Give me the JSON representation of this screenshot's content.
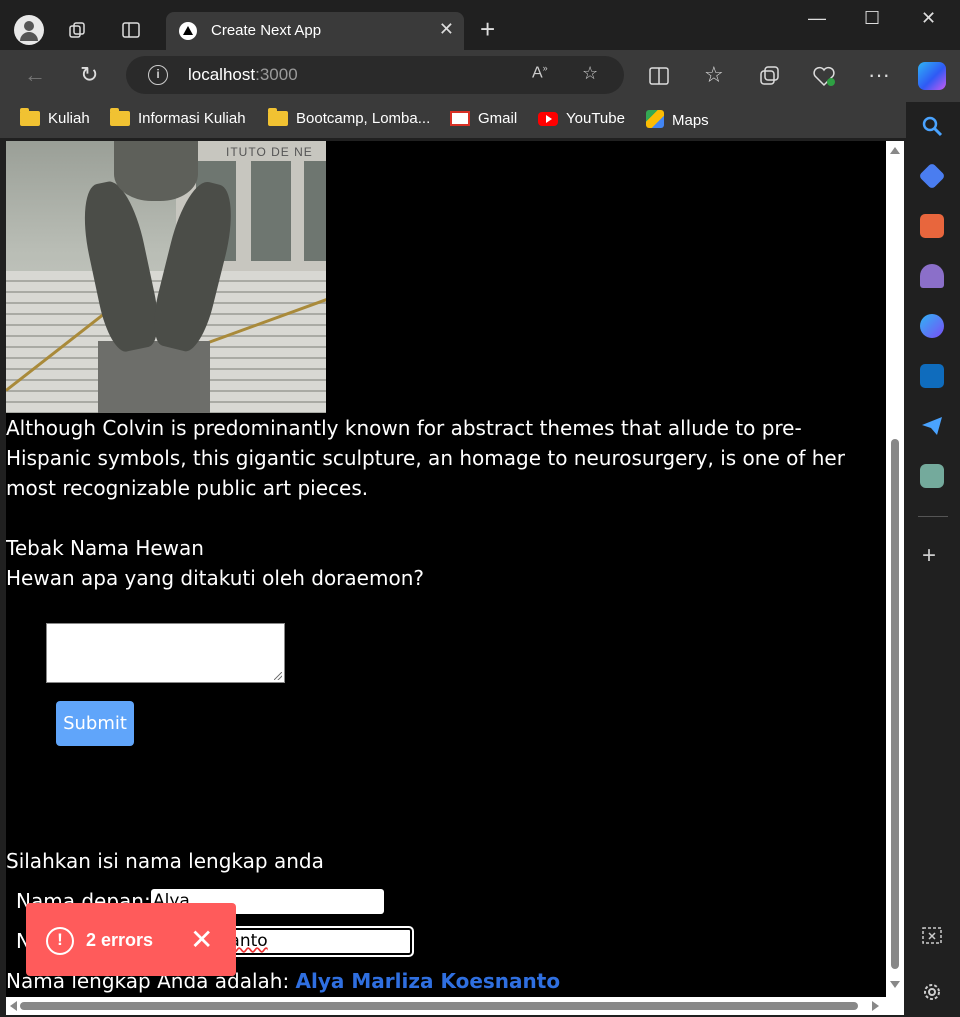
{
  "browser": {
    "tab_title": "Create Next App",
    "url_host": "localhost",
    "url_port": ":3000",
    "bookmarks": [
      "Kuliah",
      "Informasi Kuliah",
      "Bootcamp, Lomba...",
      "Gmail",
      "YouTube",
      "Maps"
    ]
  },
  "page": {
    "image_caption": "Although Colvin is predominantly known for abstract themes that allude to pre-Hispanic symbols, this gigantic sculpture, an homage to neurosurgery, is one of her most recognizable public art pieces.",
    "quiz_heading": "Tebak Nama Hewan",
    "quiz_question": "Hewan apa yang ditakuti oleh doraemon?",
    "answer_value": "",
    "submit_label": "Submit",
    "name_prompt": "Silahkan isi nama lengkap anda",
    "first_name_label": "Nama depan:",
    "first_name_value": "Alya",
    "last_name_label_visible": "N",
    "last_name_value_visible": "Koesnanto",
    "full_name_label": "Nama lengkap Anda adalah:",
    "full_name_value": "Alya Marliza Koesnanto"
  },
  "errors_toast": {
    "label": "2 errors"
  },
  "colors": {
    "submit": "#60a5fa",
    "error_toast": "#ff5b5b",
    "full_name": "#2f6fe0"
  }
}
